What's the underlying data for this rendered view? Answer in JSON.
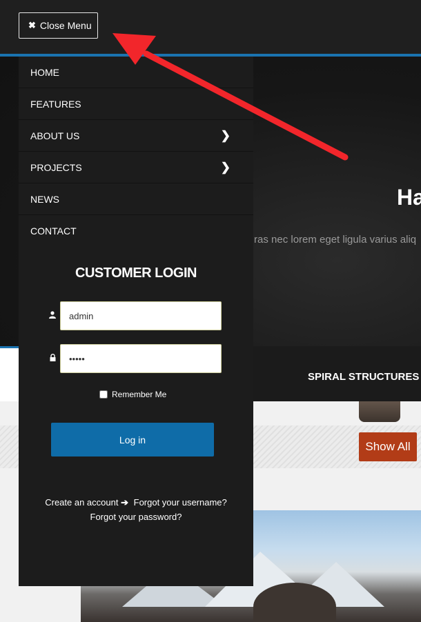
{
  "topbar": {
    "close_menu_label": "Close Menu"
  },
  "hero": {
    "title": "Ha",
    "text": "ras nec lorem eget ligula varius aliq",
    "caption": "SPIRAL STRUCTURES"
  },
  "menu": {
    "items": [
      {
        "label": "HOME",
        "has_submenu": false
      },
      {
        "label": "FEATURES",
        "has_submenu": false
      },
      {
        "label": "ABOUT US",
        "has_submenu": true
      },
      {
        "label": "PROJECTS",
        "has_submenu": true
      },
      {
        "label": "NEWS",
        "has_submenu": false
      },
      {
        "label": "CONTACT",
        "has_submenu": false
      }
    ]
  },
  "login": {
    "title": "CUSTOMER LOGIN",
    "username_value": "admin",
    "password_value": "admin",
    "remember_label": "Remember Me",
    "login_button": "Log in",
    "create_account": "Create an account",
    "forgot_username": "Forgot your username?",
    "forgot_password": "Forgot your password?"
  },
  "portfolio": {
    "show_all_label": "Show All"
  },
  "colors": {
    "accent_blue": "#1a73b0",
    "login_button": "#0f6ca8",
    "show_all": "#b23c17",
    "annotation_arrow": "#f2262b"
  }
}
